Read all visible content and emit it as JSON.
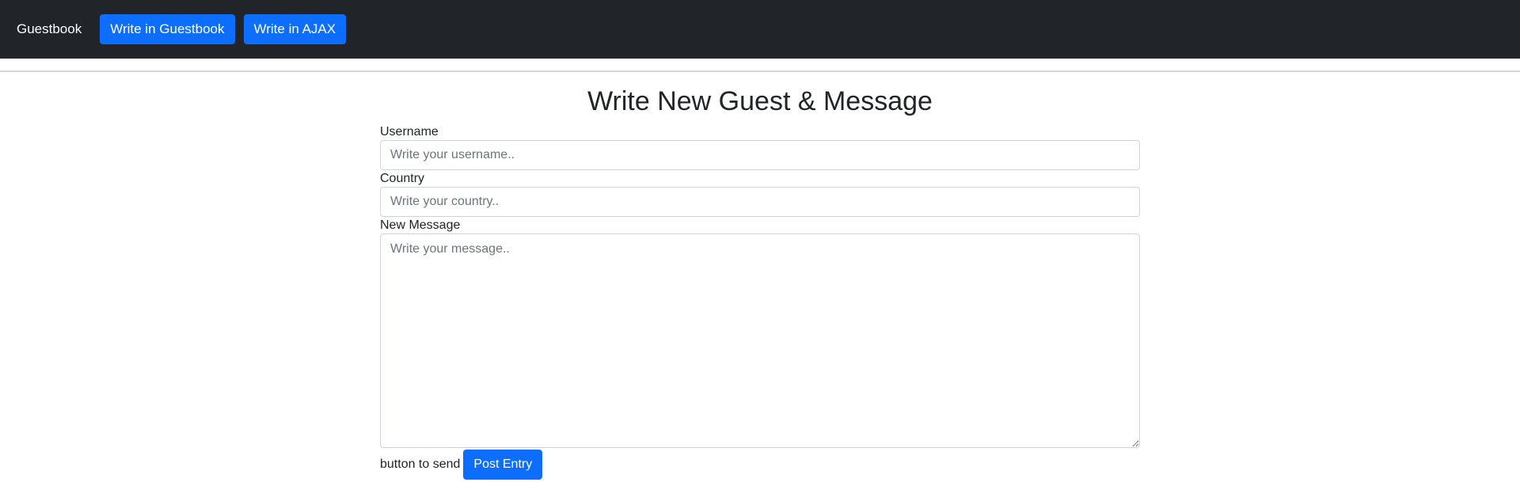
{
  "navbar": {
    "brand": "Guestbook",
    "buttons": [
      {
        "label": "Write in Guestbook"
      },
      {
        "label": "Write in AJAX"
      }
    ]
  },
  "form": {
    "title": "Write New Guest & Message",
    "username": {
      "label": "Username",
      "value": "",
      "placeholder": "Write your username.."
    },
    "country": {
      "label": "Country",
      "value": "",
      "placeholder": "Write your country.."
    },
    "message": {
      "label": "New Message",
      "value": "",
      "placeholder": "Write your message.."
    },
    "send_hint": "button to send",
    "submit_label": "Post Entry"
  },
  "colors": {
    "navbar_bg": "#212529",
    "primary": "#0d6efd",
    "input_border": "#ced4da"
  }
}
